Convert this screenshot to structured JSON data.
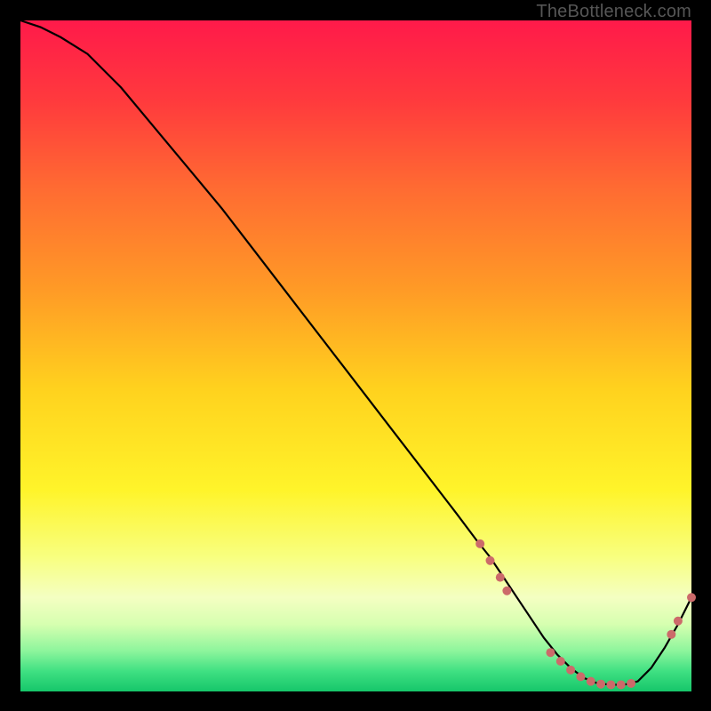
{
  "watermark": "TheBottleneck.com",
  "colors": {
    "frame": "#000000",
    "line": "#000000",
    "marker": "#cc6a6a",
    "gradient_stops": [
      {
        "pct": 0,
        "color": "#ff1a4a"
      },
      {
        "pct": 12,
        "color": "#ff3a3d"
      },
      {
        "pct": 25,
        "color": "#ff6b32"
      },
      {
        "pct": 40,
        "color": "#ff9a26"
      },
      {
        "pct": 55,
        "color": "#ffd21e"
      },
      {
        "pct": 70,
        "color": "#fff42a"
      },
      {
        "pct": 80,
        "color": "#f8ff80"
      },
      {
        "pct": 86,
        "color": "#f4ffc2"
      },
      {
        "pct": 90,
        "color": "#d6ffb0"
      },
      {
        "pct": 94,
        "color": "#8cf59c"
      },
      {
        "pct": 97,
        "color": "#3fe082"
      },
      {
        "pct": 100,
        "color": "#16c66a"
      }
    ]
  },
  "chart_data": {
    "type": "line",
    "title": "",
    "xlabel": "",
    "ylabel": "",
    "xlim": [
      0,
      100
    ],
    "ylim": [
      0,
      100
    ],
    "grid": false,
    "legend": false,
    "series": [
      {
        "name": "bottleneck-curve",
        "x": [
          0,
          3,
          6,
          10,
          15,
          20,
          25,
          30,
          35,
          40,
          45,
          50,
          55,
          60,
          65,
          68,
          70,
          72,
          74,
          76,
          78,
          80,
          82,
          84,
          86,
          88,
          90,
          92,
          94,
          96,
          98,
          100
        ],
        "y": [
          100,
          99,
          97.5,
          95,
          90,
          84,
          78,
          72,
          65.5,
          59,
          52.5,
          46,
          39.5,
          33,
          26.5,
          22.5,
          20,
          17,
          14,
          11,
          8,
          5.5,
          3.5,
          2,
          1.2,
          1,
          1,
          1.5,
          3.5,
          6.5,
          10,
          14
        ]
      }
    ],
    "markers": [
      {
        "x": 68.5,
        "y": 22.0
      },
      {
        "x": 70.0,
        "y": 19.5
      },
      {
        "x": 71.5,
        "y": 17.0
      },
      {
        "x": 72.5,
        "y": 15.0
      },
      {
        "x": 79.0,
        "y": 5.8
      },
      {
        "x": 80.5,
        "y": 4.5
      },
      {
        "x": 82.0,
        "y": 3.2
      },
      {
        "x": 83.5,
        "y": 2.2
      },
      {
        "x": 85.0,
        "y": 1.5
      },
      {
        "x": 86.5,
        "y": 1.1
      },
      {
        "x": 88.0,
        "y": 1.0
      },
      {
        "x": 89.5,
        "y": 1.0
      },
      {
        "x": 91.0,
        "y": 1.2
      },
      {
        "x": 97.0,
        "y": 8.5
      },
      {
        "x": 98.0,
        "y": 10.5
      },
      {
        "x": 100.0,
        "y": 14.0
      }
    ],
    "marker_radius_px": 5
  }
}
